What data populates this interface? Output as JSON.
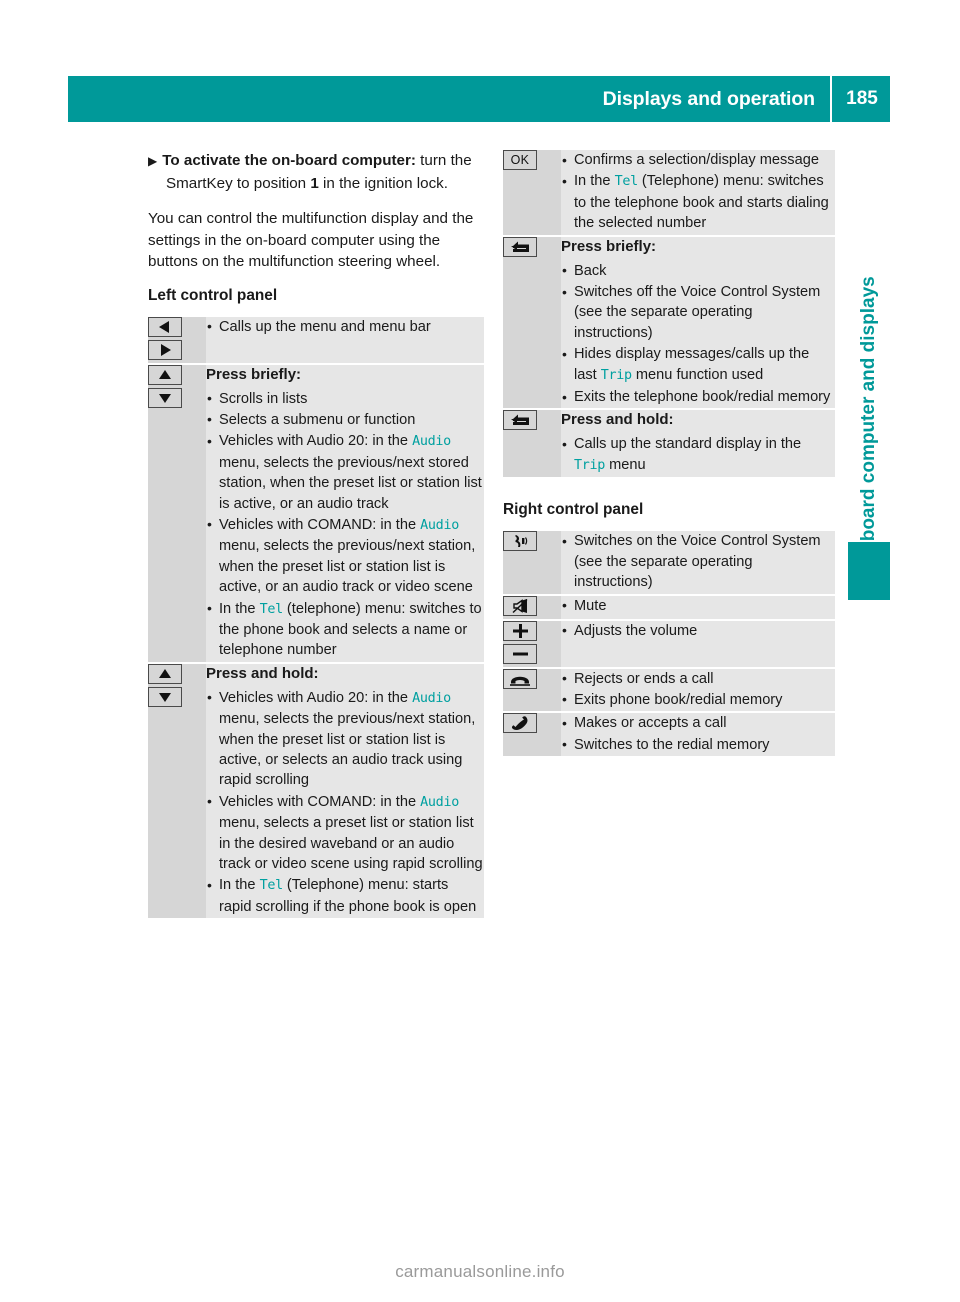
{
  "header": {
    "title": "Displays and operation",
    "page_number": "185"
  },
  "side_tab": {
    "label": "On-board computer and displays"
  },
  "footer": {
    "watermark": "carmanualsonline.info"
  },
  "colors": {
    "teal": "#009999",
    "mono_teal": "#00a0a0",
    "row_bg": "#e6e6e6",
    "icon_col_bg": "#d6d6d6"
  },
  "left_column": {
    "step": {
      "marker": "▶",
      "bold_lead": "To activate the on-board computer:",
      "rest_1": " turn the SmartKey to position ",
      "bold_value": "1",
      "rest_2": " in the ignition lock."
    },
    "paragraph": "You can control the multifunction display and the settings in the on-board computer using the buttons on the multifunction steering wheel.",
    "subhead": "Left control panel",
    "rows": [
      {
        "icons": [
          "arrow-left",
          "arrow-right"
        ],
        "title": "",
        "bullets": [
          [
            {
              "t": "Calls up the menu and menu bar"
            }
          ]
        ]
      },
      {
        "icons": [
          "arrow-up",
          "arrow-down"
        ],
        "title": "Press briefly:",
        "bullets": [
          [
            {
              "t": "Scrolls in lists"
            }
          ],
          [
            {
              "t": "Selects a submenu or function"
            }
          ],
          [
            {
              "t": "Vehicles with Audio 20: in the "
            },
            {
              "m": "Audio"
            },
            {
              "t": " menu, selects the previous/next stored station, when the preset list or station list is active, or an audio track"
            }
          ],
          [
            {
              "t": "Vehicles with COMAND: in the "
            },
            {
              "m": "Audio"
            },
            {
              "t": " menu, selects the previous/next station, when the preset list or station list is active, or an audio track or video scene"
            }
          ],
          [
            {
              "t": "In the "
            },
            {
              "m": "Tel"
            },
            {
              "t": " (telephone) menu: switches to the phone book and selects a name or telephone number"
            }
          ]
        ]
      },
      {
        "icons": [
          "arrow-up",
          "arrow-down"
        ],
        "title": "Press and hold:",
        "bullets": [
          [
            {
              "t": "Vehicles with Audio 20: in the "
            },
            {
              "m": "Audio"
            },
            {
              "t": " menu, selects the previous/next station, when the preset list or station list is active, or selects an audio track using rapid scrolling"
            }
          ],
          [
            {
              "t": "Vehicles with COMAND: in the "
            },
            {
              "m": "Audio"
            },
            {
              "t": " menu, selects a preset list or station list in the desired waveband or an audio track or video scene using rapid scrolling"
            }
          ],
          [
            {
              "t": "In the "
            },
            {
              "m": "Tel"
            },
            {
              "t": " (Telephone) menu: starts rapid scrolling if the phone book is open"
            }
          ]
        ]
      }
    ]
  },
  "right_column": {
    "rows_top": [
      {
        "icons": [
          "ok-key"
        ],
        "title": "",
        "bullets": [
          [
            {
              "t": "Confirms a selection/display message"
            }
          ],
          [
            {
              "t": "In the "
            },
            {
              "m": "Tel"
            },
            {
              "t": " (Telephone) menu: switches to the telephone book and starts dialing the selected number"
            }
          ]
        ]
      },
      {
        "icons": [
          "back-key"
        ],
        "title": "Press briefly:",
        "bullets": [
          [
            {
              "t": "Back"
            }
          ],
          [
            {
              "t": "Switches off the Voice Control System (see the separate operating instructions)"
            }
          ],
          [
            {
              "t": "Hides display messages/calls up the last "
            },
            {
              "m": "Trip"
            },
            {
              "t": " menu function used"
            }
          ],
          [
            {
              "t": "Exits the telephone book/redial memory"
            }
          ]
        ]
      },
      {
        "icons": [
          "back-key"
        ],
        "title": "Press and hold:",
        "bullets": [
          [
            {
              "t": "Calls up the standard display in the "
            },
            {
              "m": "Trip"
            },
            {
              "t": " menu"
            }
          ]
        ]
      }
    ],
    "subhead": "Right control panel",
    "rows_bottom": [
      {
        "icons": [
          "voice-control-key"
        ],
        "title": "",
        "bullets": [
          [
            {
              "t": "Switches on the Voice Control System (see the separate operating instructions)"
            }
          ]
        ]
      },
      {
        "icons": [
          "mute-key"
        ],
        "title": "",
        "bullets": [
          [
            {
              "t": "Mute"
            }
          ]
        ]
      },
      {
        "icons": [
          "plus-key",
          "minus-key"
        ],
        "title": "",
        "bullets": [
          [
            {
              "t": "Adjusts the volume"
            }
          ]
        ]
      },
      {
        "icons": [
          "phone-end-key"
        ],
        "title": "",
        "bullets": [
          [
            {
              "t": "Rejects or ends a call"
            }
          ],
          [
            {
              "t": "Exits phone book/redial memory"
            }
          ]
        ]
      },
      {
        "icons": [
          "phone-call-key"
        ],
        "title": "",
        "bullets": [
          [
            {
              "t": "Makes or accepts a call"
            }
          ],
          [
            {
              "t": "Switches to the redial memory"
            }
          ]
        ]
      }
    ]
  }
}
